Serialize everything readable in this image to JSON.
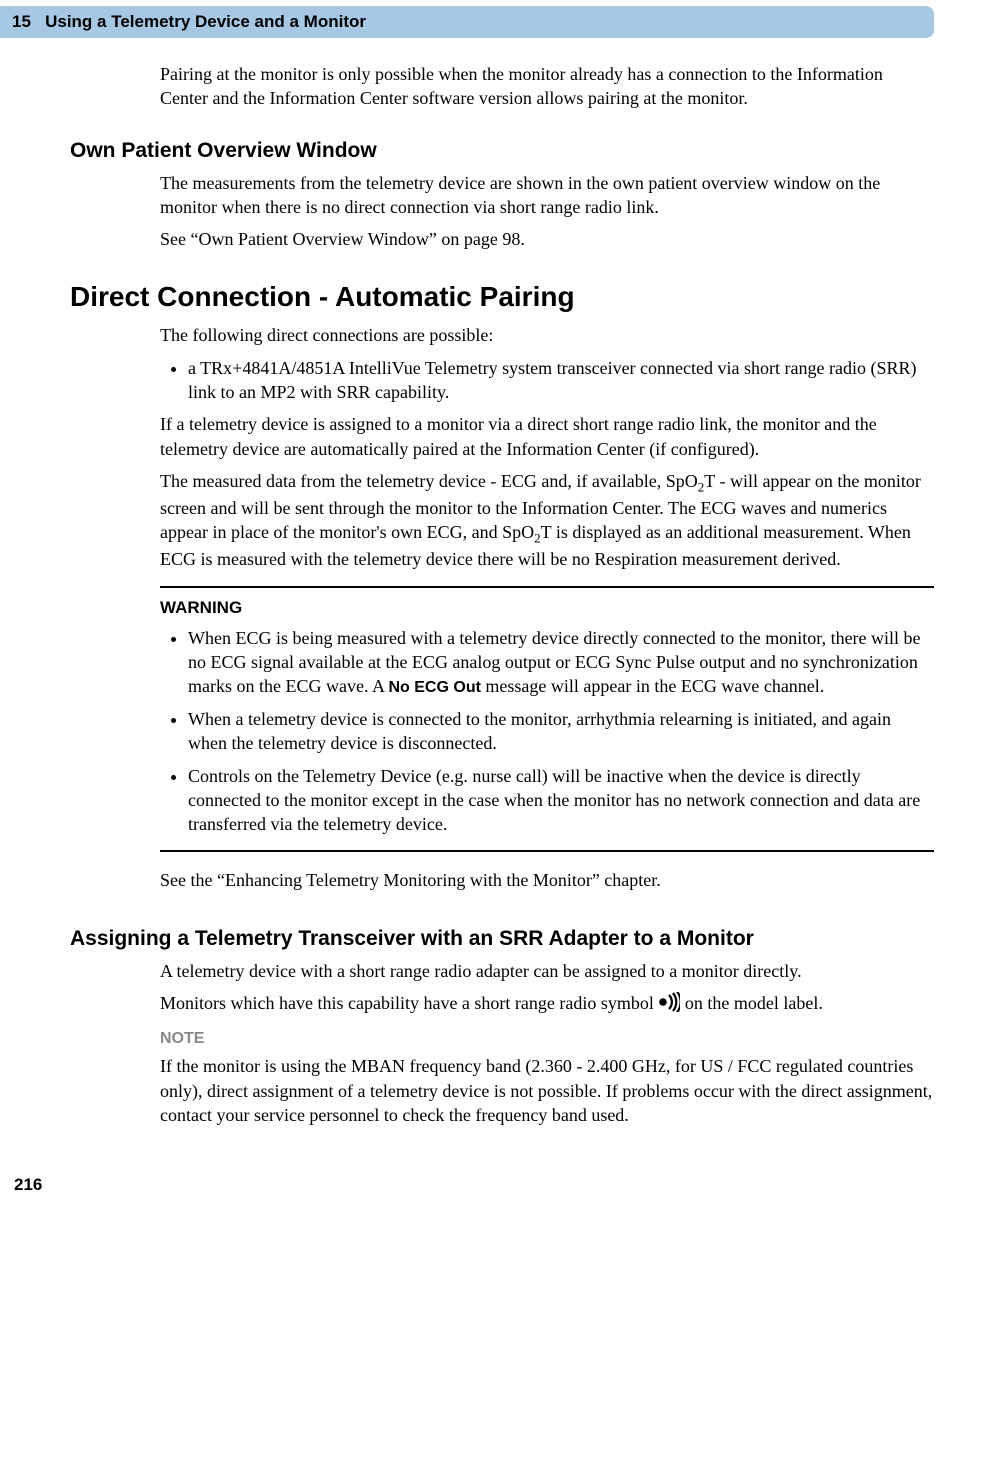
{
  "header": {
    "chapter_num": "15",
    "chapter_title": "Using a Telemetry Device and a Monitor"
  },
  "intro_para": "Pairing at the monitor is only possible when the monitor already has a connection to the Information Center and the Information Center software version allows pairing at the monitor.",
  "sec_own": {
    "title": "Own Patient Overview Window",
    "p1": "The measurements from the telemetry device are shown in the own patient overview window on the monitor when there is no direct connection via short range radio link.",
    "p2": "See “Own Patient Overview Window” on page 98."
  },
  "sec_direct": {
    "title": "Direct Connection - Automatic Pairing",
    "lead": "The following direct connections are possible:",
    "bullet1": "a TRx+4841A/4851A IntelliVue Telemetry system transceiver connected via short range radio (SRR) link to an MP2 with SRR capability.",
    "p_after": "If a telemetry device is assigned to a monitor via a direct short range radio link, the monitor and the telemetry device are automatically paired at the Information Center (if configured).",
    "p3_a": "The measured data from the telemetry device - ECG and, if available, SpO",
    "p3_sub1": "2",
    "p3_b": "T - will appear on the monitor screen and will be sent through the monitor to the Information Center. The ECG waves and numerics appear in place of the monitor's own ECG, and SpO",
    "p3_sub2": "2",
    "p3_c": "T is displayed as an additional measurement. When ECG is measured with the telemetry device there will be no Respiration measurement derived."
  },
  "warning": {
    "label": "WARNING",
    "b1_a": "When ECG is being measured with a telemetry device directly connected to the monitor, there will be no ECG signal available at the ECG analog output or ECG Sync Pulse output and no synchronization marks on the ECG wave. A ",
    "b1_msg": "No ECG Out",
    "b1_b": " message will appear in the ECG wave channel.",
    "b2": "When a telemetry device is connected to the monitor, arrhythmia relearning is initiated, and again when the telemetry device is disconnected.",
    "b3": "Controls on the Telemetry Device (e.g. nurse call) will be inactive when the device is directly connected to the monitor except in the case when the monitor has no network connection and data are transferred via the telemetry device."
  },
  "see_enh": "See the “Enhancing Telemetry Monitoring with the Monitor” chapter.",
  "sec_assign": {
    "title": "Assigning a Telemetry Transceiver with an SRR Adapter to a Monitor",
    "p1": "A telemetry device with a short range radio adapter can be assigned to a monitor directly.",
    "p2a": "Monitors which have this capability have a short range radio symbol ",
    "p2b": " on the model label.",
    "note_label": "NOTE",
    "note_body": "If the monitor is using the MBAN frequency band (2.360 - 2.400 GHz, for US / FCC regulated countries only), direct assignment of a telemetry device is not possible. If problems occur with the direct assignment, contact your service personnel to check the frequency band used."
  },
  "page_num": "216"
}
